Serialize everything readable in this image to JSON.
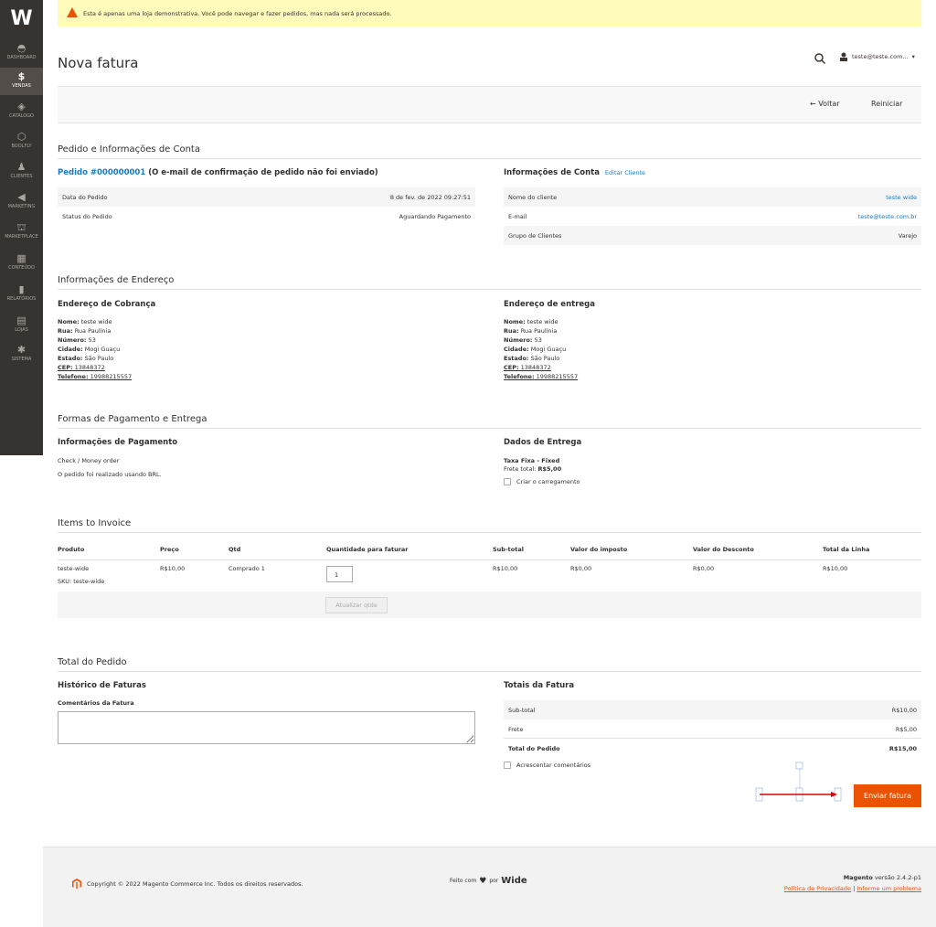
{
  "sidebar": {
    "logo": "W",
    "items": [
      {
        "label": "DASHBOARD",
        "icon": "speedometer-icon",
        "glyph": "◓"
      },
      {
        "label": "VENDAS",
        "icon": "dollar-icon",
        "glyph": "$"
      },
      {
        "label": "CATÁLOGO",
        "icon": "box-icon",
        "glyph": "◈"
      },
      {
        "label": "BOOLFLY",
        "icon": "hexagon-icon",
        "glyph": "⬡"
      },
      {
        "label": "CLIENTES",
        "icon": "person-icon",
        "glyph": "♟"
      },
      {
        "label": "MARKETING",
        "icon": "megaphone-icon",
        "glyph": "◀"
      },
      {
        "label": "MARKETPLACE",
        "icon": "storefront-icon",
        "glyph": "⛫"
      },
      {
        "label": "CONTEÚDO",
        "icon": "content-icon",
        "glyph": "▦"
      },
      {
        "label": "RELATÓRIOS",
        "icon": "bar-chart-icon",
        "glyph": "▮"
      },
      {
        "label": "LOJAS",
        "icon": "store-icon",
        "glyph": "▤"
      },
      {
        "label": "SISTEMA",
        "icon": "gear-icon",
        "glyph": "✱"
      }
    ]
  },
  "notice": "Esta é apenas uma loja demonstrativa. Você pode navegar e fazer pedidos, mas nada será processado.",
  "page_title": "Nova fatura",
  "user": {
    "email": "teste@teste.com...",
    "caret": "▾"
  },
  "actions": {
    "back": "←  Voltar",
    "reset": "Reiniciar"
  },
  "order_section": {
    "title": "Pedido e Informações de Conta",
    "order_link": "Pedido #000000001",
    "order_note": " (O e-mail de confirmação de pedido não foi enviado)",
    "rows": [
      {
        "label": "Data do Pedido",
        "value": "8 de fev. de 2022 09:27:51"
      },
      {
        "label": "Status do Pedido",
        "value": "Aguardando Pagamento"
      }
    ],
    "account_title": "Informações de Conta",
    "edit_customer": "Editar Cliente",
    "account_rows": [
      {
        "label": "Nome do cliente",
        "value": "teste wide"
      },
      {
        "label": "E-mail",
        "value": "teste@teste.com.br"
      },
      {
        "label": "Grupo de Clientes",
        "value": "Varejo"
      }
    ]
  },
  "address_section": {
    "title": "Informações de Endereço",
    "billing_title": "Endereço de Cobrança",
    "shipping_title": "Endereço de entrega",
    "labels": {
      "name": "Nome:",
      "street": "Rua:",
      "number": "Número:",
      "city": "Cidade:",
      "state": "Estado:",
      "cep": "CEP:",
      "phone": "Telefone:"
    },
    "billing": {
      "name": " teste wide",
      "street": " Rua Paulínia",
      "number": " 53",
      "city": " Mogi Guaçu",
      "state": " São Paulo",
      "cep": " 13848372",
      "phone": " 19988215557"
    },
    "shipping": {
      "name": " teste wide",
      "street": " Rua Paulínia",
      "number": " 53",
      "city": " Mogi Guaçu",
      "state": " São Paulo",
      "cep": " 13848372",
      "phone": " 19988215557"
    }
  },
  "payment_section": {
    "title": "Formas de Pagamento e Entrega",
    "payment_title": "Informações de Pagamento",
    "payment_method": "Check / Money order",
    "payment_note": "O pedido foi realizado usando BRL.",
    "shipping_title": "Dados de Entrega",
    "shipping_method": "Taxa Fixa - Fixed",
    "freight_label": "Frete total: ",
    "freight_value": "R$5,00",
    "create_shipment": "Criar o carregamento"
  },
  "items_section": {
    "title": "Items to Invoice",
    "headers": [
      "Produto",
      "Preço",
      "Qtd",
      "Quantidade para faturar",
      "Sub-total",
      "Valor do imposto",
      "Valor do Desconto",
      "Total da Linha"
    ],
    "row": {
      "product": "teste-wide",
      "sku": "SKU: teste-wide",
      "price": "R$10,00",
      "qty": "Comprado 1",
      "qty_invoice": "1",
      "subtotal": "R$10,00",
      "tax": "R$0,00",
      "discount": "R$0,00",
      "total": "R$10,00"
    },
    "update_button": "Atualizar qtde"
  },
  "totals_section": {
    "title": "Total do Pedido",
    "history_title": "Histórico de Faturas",
    "comments_label": "Comentários da Fatura",
    "invoice_totals_title": "Totais da Fatura",
    "rows": [
      {
        "label": "Sub-total",
        "value": "R$10,00"
      },
      {
        "label": "Frete",
        "value": "R$5,00"
      },
      {
        "label": "Total do Pedido",
        "value": "R$15,00"
      }
    ],
    "add_comments": "Acrescentar comentários",
    "submit": "Enviar fatura"
  },
  "footer": {
    "copyright": "Copyright © 2022 Magento Commerce Inc. Todos os direitos reservados.",
    "made_with": "Feito com",
    "by": "por",
    "brand": "Wide",
    "magento": "Magento",
    "version": " versão 2.4.2-p1",
    "privacy": "Política de Privacidade",
    "separator": " | ",
    "report": "Informe um problema"
  },
  "colors": {
    "accent": "#eb5202",
    "link": "#1979c3",
    "sidebar": "#373330",
    "notice": "#fffbbb"
  }
}
